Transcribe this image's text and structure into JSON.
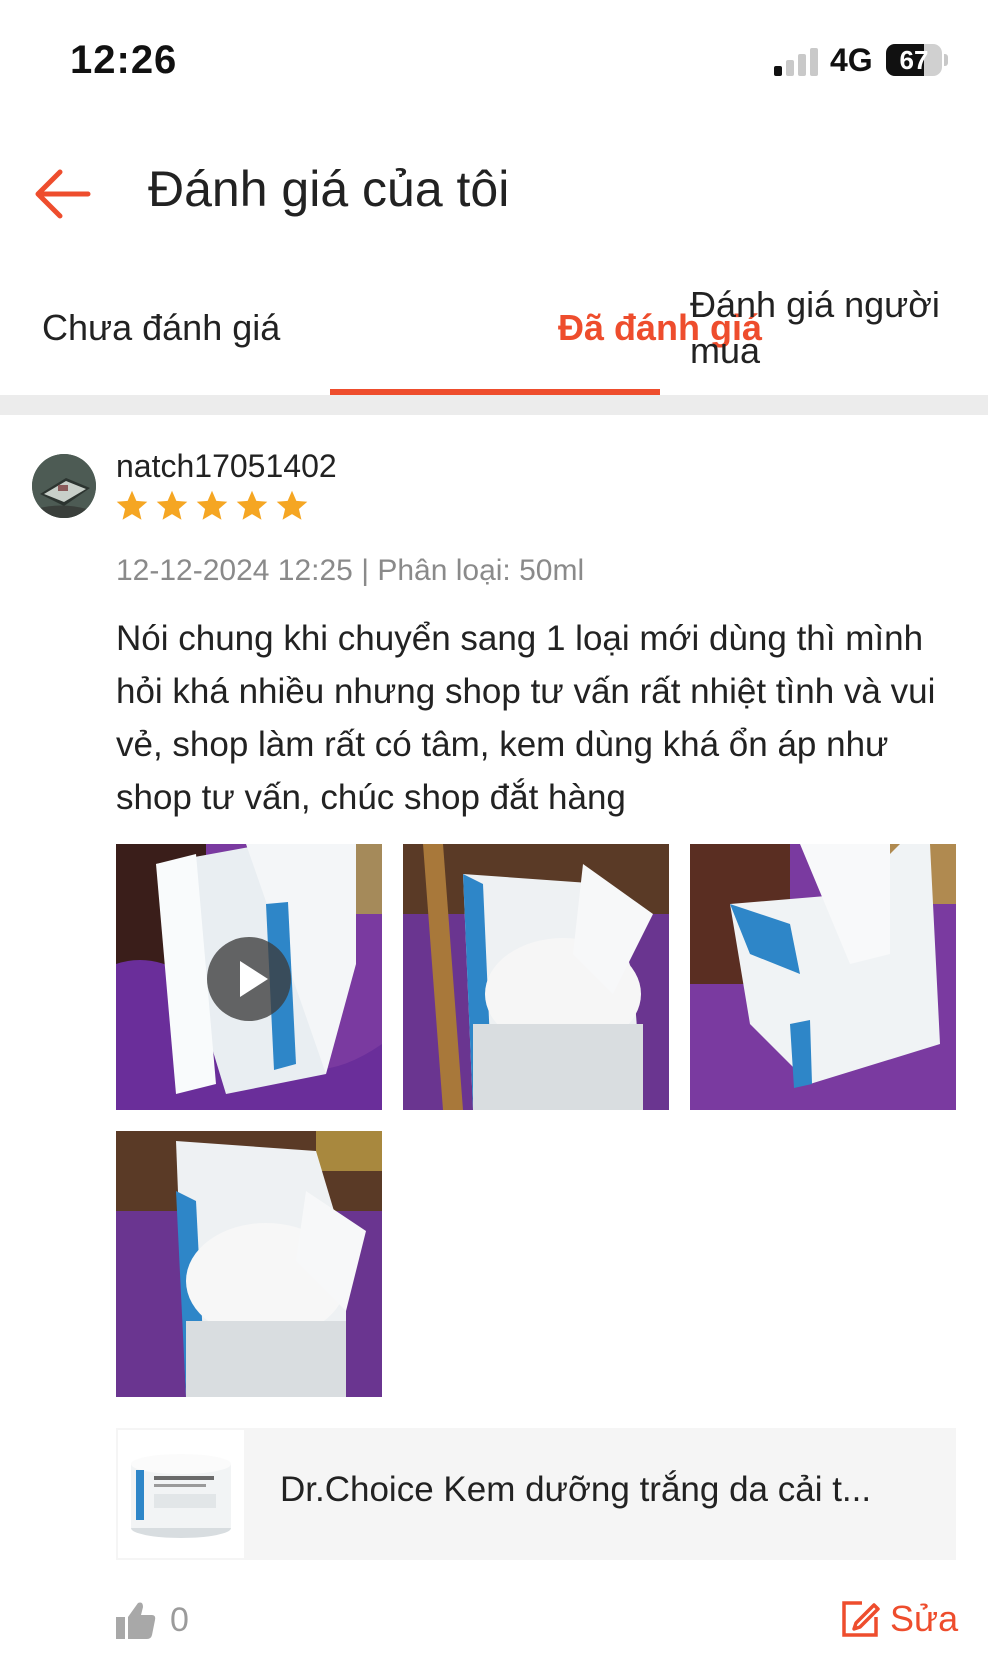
{
  "status_bar": {
    "time": "12:26",
    "network": "4G",
    "battery": "67",
    "battery_level": 0.67
  },
  "header": {
    "title": "Đánh giá của tôi",
    "back_icon": "arrow-left-icon"
  },
  "tabs": [
    {
      "label": "Chưa đánh giá",
      "active": false
    },
    {
      "label": "Đã đánh giá",
      "active": true
    },
    {
      "label": "Đánh giá người mua",
      "active": false
    }
  ],
  "review": {
    "username": "natch17051402",
    "rating": 5,
    "date": "12-12-2024 12:25",
    "variation": "Phân loại: 50ml",
    "meta_text": "12-12-2024 12:25 | Phân loại: 50ml",
    "text": "Nói chung khi chuyển sang 1 loại mới dùng thì mình hỏi khá nhiều nhưng shop tư vấn rất nhiệt tình và vui vẻ, shop làm rất có tâm, kem dùng khá ổn áp như shop tư vấn, chúc shop đắt hàng",
    "media": [
      {
        "type": "video"
      },
      {
        "type": "image"
      },
      {
        "type": "image"
      },
      {
        "type": "image"
      }
    ],
    "product": {
      "name": "Dr.Choice Kem dưỡng trắng da cải t..."
    },
    "likes": "0",
    "edit_label": "Sửa"
  },
  "colors": {
    "accent": "#ee4d2d",
    "star": "#f5a623",
    "muted": "#8a8a8a"
  }
}
